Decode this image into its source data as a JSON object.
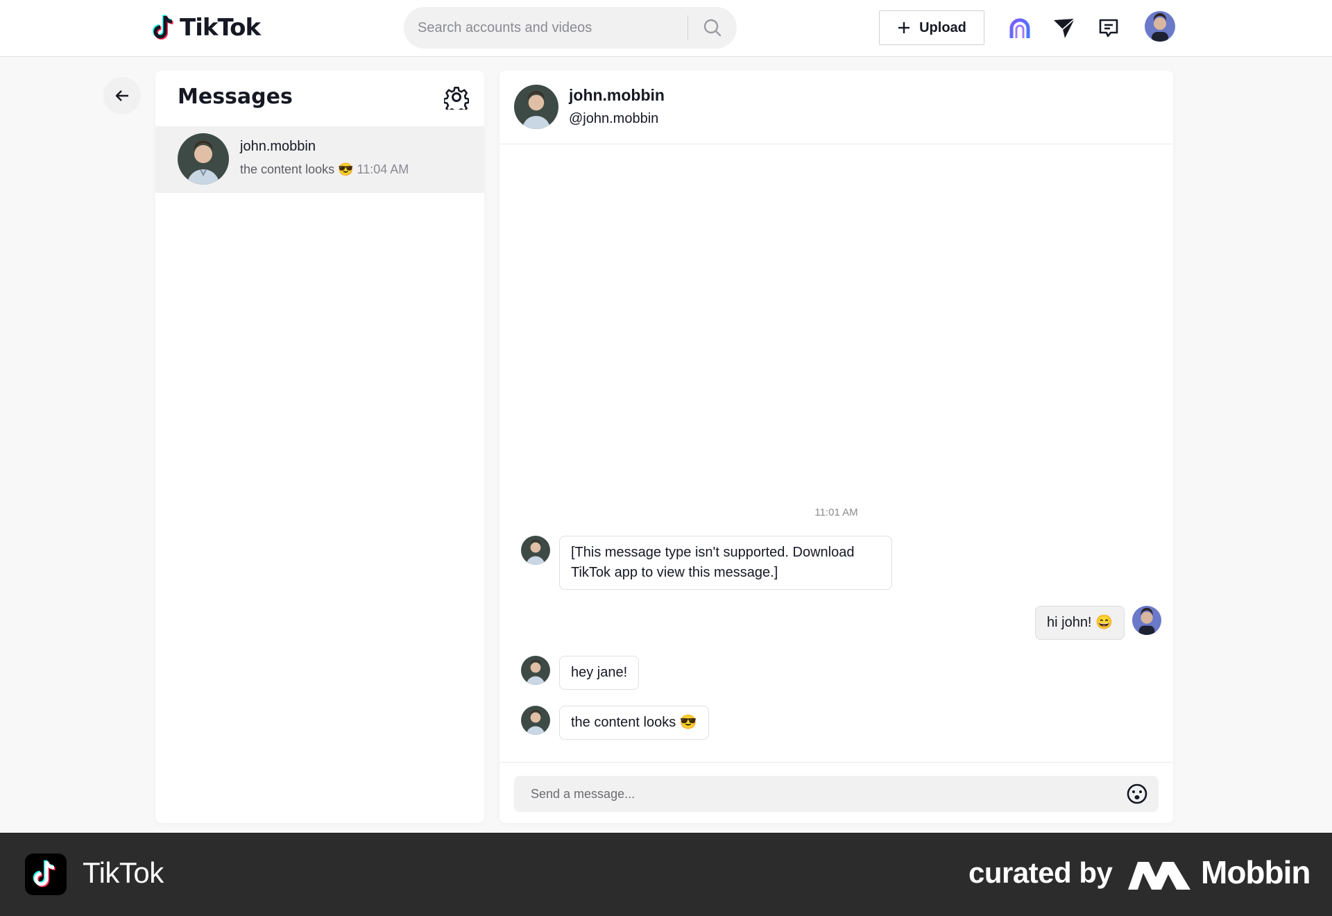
{
  "header": {
    "brand": "TikTok",
    "search": {
      "placeholder": "Search accounts and videos"
    },
    "upload_label": "Upload",
    "icons": [
      "creator-tools-icon",
      "send-icon",
      "inbox-icon"
    ]
  },
  "sidebar": {
    "title": "Messages",
    "conversations": [
      {
        "name": "john.mobbin",
        "preview": "the content looks 😎",
        "time": "11:04 AM"
      }
    ]
  },
  "chat": {
    "name": "john.mobbin",
    "handle": "@john.mobbin",
    "timestamp": "11:01 AM",
    "messages": [
      {
        "from": "john.mobbin",
        "text": "[This message type isn't supported. Download TikTok app to view this message.]"
      },
      {
        "from": "me",
        "text": "hi john! 😄"
      },
      {
        "from": "john.mobbin",
        "text": "hey jane!"
      },
      {
        "from": "john.mobbin",
        "text": "the content looks 😎"
      }
    ],
    "composer_placeholder": "Send a message..."
  },
  "footer": {
    "app_name": "TikTok",
    "curated_by": "curated by",
    "brand": "Mobbin"
  },
  "colors": {
    "tiktok_cyan": "#25f4ee",
    "tiktok_red": "#fe2c55",
    "text": "#161823",
    "selected_bg": "#f1f1f2",
    "footer_bg": "#2c2c2c"
  }
}
